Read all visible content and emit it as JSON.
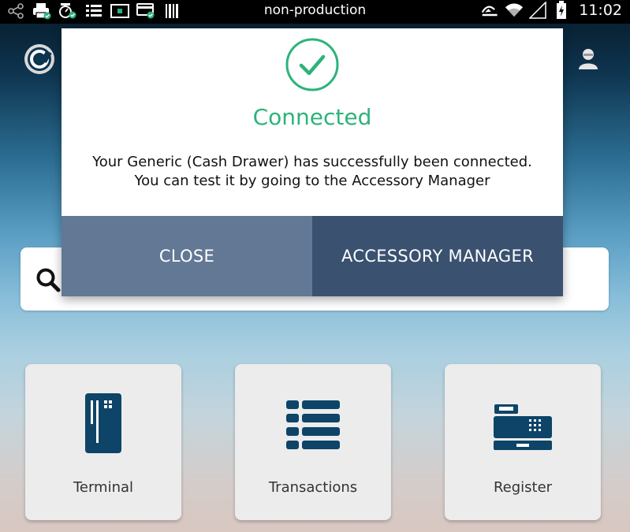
{
  "status_bar": {
    "title": "non-production",
    "time": "11:02",
    "icons_left": [
      "share-icon",
      "printer-icon",
      "scale-icon",
      "list-icon",
      "card-reader-icon",
      "card-icon",
      "barcode-icon"
    ],
    "icons_right": [
      "cast-icon",
      "wifi-icon",
      "signal-icon",
      "battery-charging-icon"
    ]
  },
  "dialog": {
    "title": "Connected",
    "message_line1": "Your Generic (Cash Drawer) has successfully been connected.",
    "message_line2": "You can test it by going to the Accessory Manager",
    "close_label": "CLOSE",
    "accessory_label": "ACCESSORY MANAGER",
    "accent_color": "#2db37a"
  },
  "tiles": [
    {
      "label": "Terminal",
      "icon": "terminal-icon"
    },
    {
      "label": "Transactions",
      "icon": "transactions-icon"
    },
    {
      "label": "Register",
      "icon": "register-icon"
    }
  ],
  "colors": {
    "icon_color": "#0d4467",
    "close_button": "#627895",
    "accessory_button": "#3a5270"
  }
}
